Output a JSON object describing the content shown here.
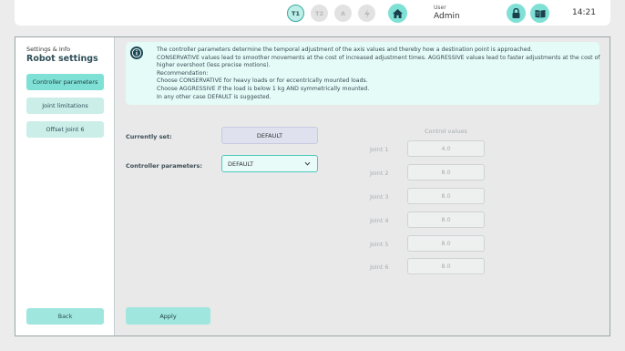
{
  "header": {
    "modes": [
      "T1",
      "T2",
      "A"
    ],
    "user_label": "User",
    "user_value": "Admin",
    "clock": "14:21"
  },
  "sidebar": {
    "subtitle": "Settings & Info",
    "title": "Robot settings",
    "items": [
      {
        "label": "Controller parameters",
        "active": true
      },
      {
        "label": "Joint limitations",
        "active": false
      },
      {
        "label": "Offset Joint 6",
        "active": false
      }
    ],
    "back_label": "Back"
  },
  "info": {
    "lines": [
      "The controller parameters determine the temporal adjustment of the axis values and thereby how a destination point is approached.",
      "CONSERVATIVE values lead to smoother movements at the cost of increased adjustment times. AGGRESSIVE values lead to faster adjustments at the cost of",
      "higher overshoot (less precise motions).",
      "Recommendation:",
      "Choose CONSERVATIVE for heavy loads or for eccentrically mounted loads.",
      "Choose AGGRESSIVE if the load is below 1 kg AND symmetrically mounted.",
      "In any other case DEFAULT is suggested."
    ]
  },
  "form": {
    "currently_set_label": "Currently set:",
    "currently_set_value": "DEFAULT",
    "params_label": "Controller parameters:",
    "params_value": "DEFAULT",
    "apply_label": "Apply"
  },
  "control_values": {
    "title": "Control values",
    "joints": [
      {
        "label": "Joint 1",
        "value": "4.0"
      },
      {
        "label": "Joint 2",
        "value": "8.0"
      },
      {
        "label": "Joint 3",
        "value": "8.0"
      },
      {
        "label": "Joint 4",
        "value": "8.0"
      },
      {
        "label": "Joint 5",
        "value": "8.0"
      },
      {
        "label": "Joint 6",
        "value": "8.0"
      }
    ]
  },
  "colors": {
    "accent": "#7fe0d6",
    "accent_light": "#cbeee9",
    "info_bg": "#e5fbf8",
    "dark_icon": "#1b4a57"
  },
  "icons": [
    "lightning-icon",
    "home-icon",
    "lock-icon",
    "book-icon",
    "info-icon",
    "chevron-down-icon"
  ]
}
